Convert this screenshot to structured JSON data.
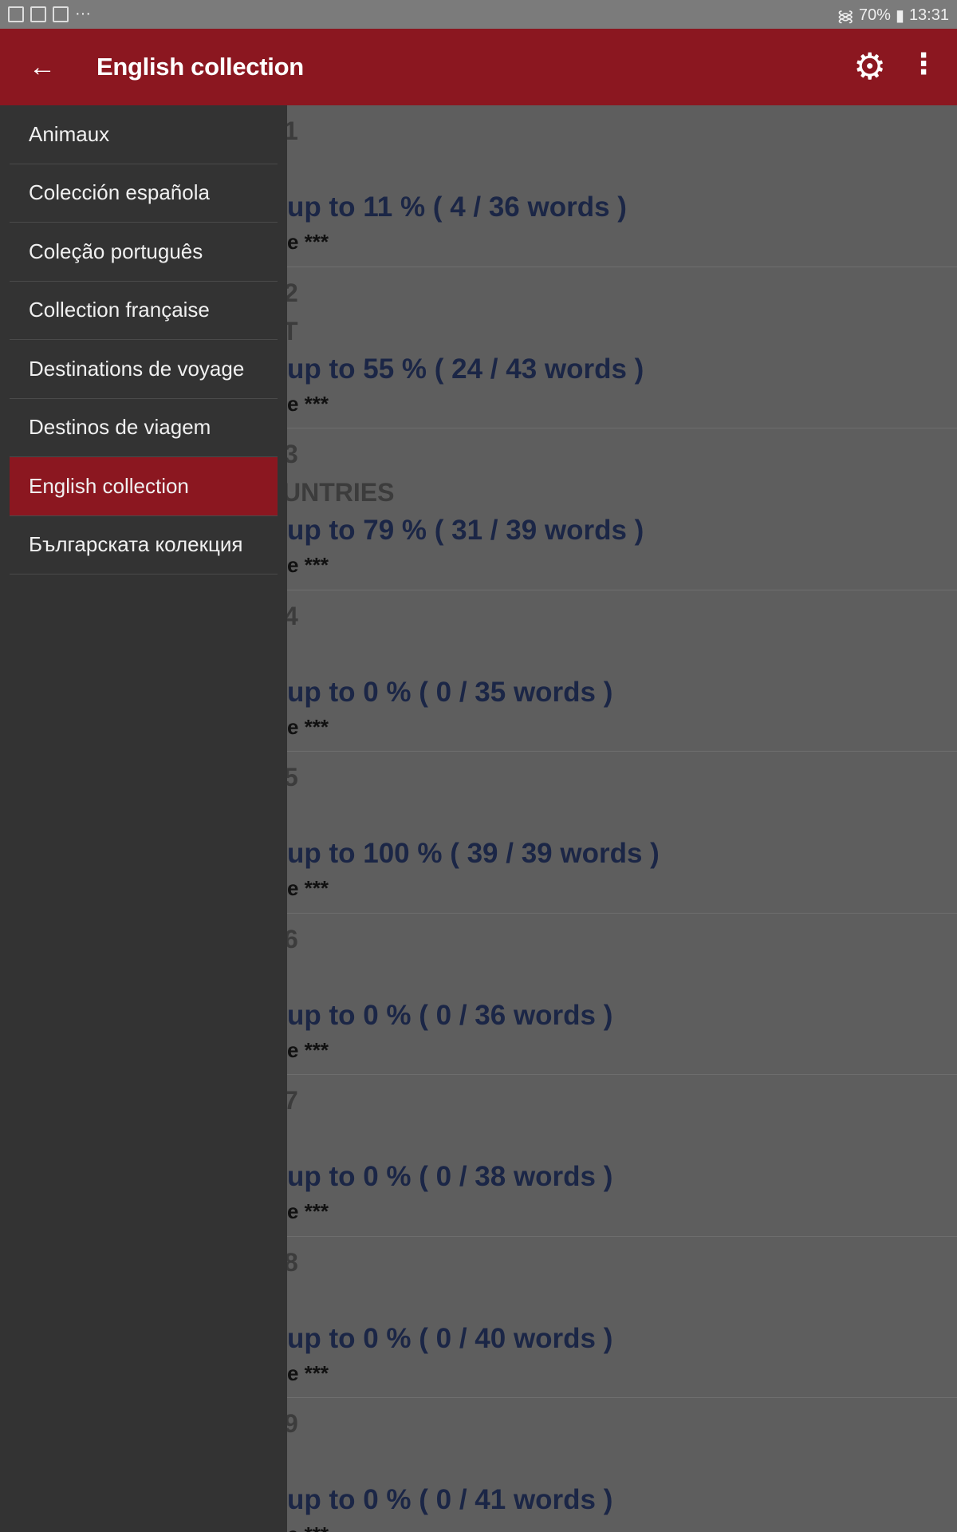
{
  "status_bar": {
    "battery": "70%",
    "time": "13:31",
    "icons": [
      "teams-icon",
      "calendar-icon",
      "image-icon",
      "more-dots-icon",
      "wifi-icon",
      "battery-icon"
    ]
  },
  "app_bar": {
    "title": "English collection",
    "back_icon": "arrow-left-icon",
    "settings_icon": "gear-icon",
    "menu_icon": "more-vert-icon",
    "color": "#8b1720"
  },
  "drawer": {
    "items": [
      {
        "label": "Animaux",
        "active": false
      },
      {
        "label": "Colección española",
        "active": false
      },
      {
        "label": "Coleção português",
        "active": false
      },
      {
        "label": "Collection française",
        "active": false
      },
      {
        "label": "Destinations de voyage",
        "active": false
      },
      {
        "label": "Destinos de viagem",
        "active": false
      },
      {
        "label": "English collection",
        "active": true
      },
      {
        "label": "Българската колекция",
        "active": false
      }
    ]
  },
  "lessons": [
    {
      "num": "1",
      "title": "",
      "progress": "up to 11 % ( 4 / 36 words )",
      "stars": "e ***"
    },
    {
      "num": "2",
      "title": "T",
      "progress": "up to 55 % ( 24 / 43 words )",
      "stars": "e ***"
    },
    {
      "num": "3",
      "title": "UNTRIES",
      "progress": "up to 79 % ( 31 / 39 words )",
      "stars": "e ***"
    },
    {
      "num": "4",
      "title": "",
      "progress": "up to 0 % ( 0 / 35 words )",
      "stars": "e ***"
    },
    {
      "num": "5",
      "title": "",
      "progress": "up to 100 % ( 39 / 39 words )",
      "stars": "e ***"
    },
    {
      "num": "6",
      "title": "",
      "progress": "up to 0 % ( 0 / 36 words )",
      "stars": "e ***"
    },
    {
      "num": "7",
      "title": "",
      "progress": "up to 0 % ( 0 / 38 words )",
      "stars": "e ***"
    },
    {
      "num": "8",
      "title": "",
      "progress": "up to 0 % ( 0 / 40 words )",
      "stars": "e ***"
    },
    {
      "num": "9",
      "title": "",
      "progress": "up to 0 % ( 0 / 41 words )",
      "stars": "e ***"
    }
  ]
}
